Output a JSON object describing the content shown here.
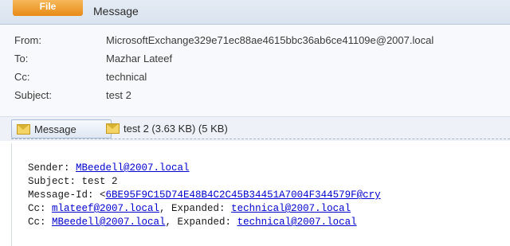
{
  "ribbon": {
    "file_tab": "File",
    "message_tab": "Message"
  },
  "header": {
    "from_label": "From:",
    "from_value": "MicrosoftExchange329e71ec88ae4615bbc36ab6ce41109e@2007.local",
    "to_label": "To:",
    "to_value": "Mazhar Lateef",
    "cc_label": "Cc:",
    "cc_value": "technical",
    "subject_label": "Subject:",
    "subject_value": "test 2"
  },
  "attachments": {
    "message_tab": "Message",
    "file_label": "test 2 (3.63 KB) (5 KB)"
  },
  "body": {
    "sender_prefix": "Sender: ",
    "sender_link": "MBeedell@2007.local",
    "subject_line": "Subject: test 2",
    "message_id_prefix": "Message-Id: <",
    "message_id_link": "6BE95F9C15D74E48B4C2C45B34451A7004F344579F@cry",
    "cc1_prefix": "Cc: ",
    "cc1_link": "mlateef@2007.local",
    "cc1_mid": ", Expanded: ",
    "cc1_expanded": "technical@2007.local",
    "cc2_prefix": "Cc: ",
    "cc2_link": "MBeedell@2007.local",
    "cc2_mid": ", Expanded: ",
    "cc2_expanded": "technical@2007.local"
  },
  "colors": {
    "file_tab": "#e88a17",
    "link": "#0000cc",
    "header_bg": "#f7f9fc"
  },
  "icons": {
    "message_tab_icon": "envelope-icon",
    "attachment_icon": "envelope-icon"
  }
}
